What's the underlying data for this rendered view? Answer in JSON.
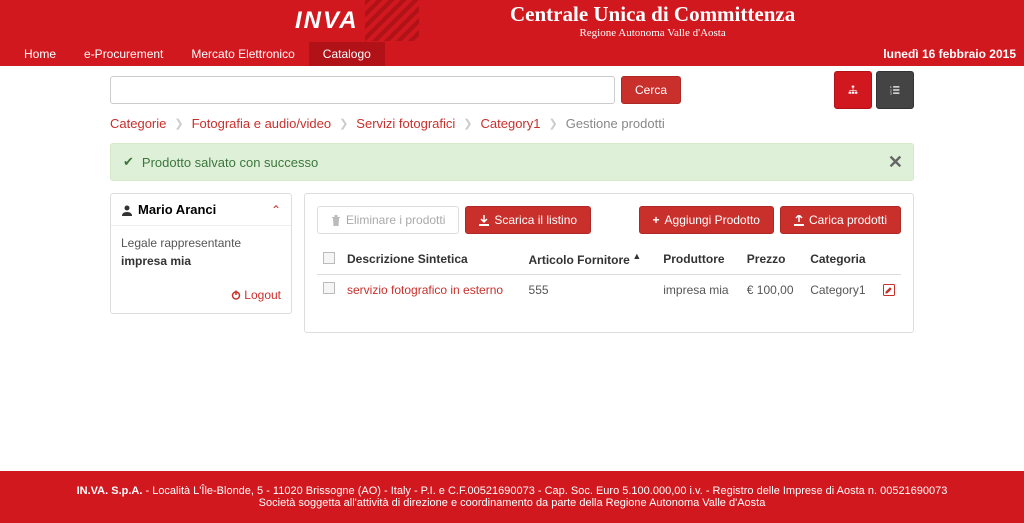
{
  "header": {
    "logo": "INVA",
    "title": "Centrale Unica di Committenza",
    "subtitle": "Regione Autonoma Valle d'Aosta"
  },
  "nav": {
    "items": [
      "Home",
      "e-Procurement",
      "Mercato Elettronico",
      "Catalogo"
    ],
    "active_index": 3,
    "date": "lunedì 16 febbraio 2015"
  },
  "search": {
    "placeholder": "",
    "value": "",
    "button": "Cerca"
  },
  "breadcrumb": {
    "items": [
      "Categorie",
      "Fotografia e audio/video",
      "Servizi fotografici",
      "Category1"
    ],
    "current": "Gestione prodotti"
  },
  "alert": {
    "message": "Prodotto salvato con successo"
  },
  "sidebar": {
    "user": "Mario Aranci",
    "role": "Legale rappresentante",
    "company": "impresa mia",
    "logout": "Logout"
  },
  "toolbar": {
    "delete": "Eliminare i prodotti",
    "download": "Scarica il listino",
    "add": "Aggiungi Prodotto",
    "upload": "Carica prodotti"
  },
  "table": {
    "headers": {
      "desc": "Descrizione Sintetica",
      "article": "Articolo Fornitore",
      "producer": "Produttore",
      "price": "Prezzo",
      "category": "Categoria"
    },
    "sorted_column": "article",
    "rows": [
      {
        "desc": "servizio fotografico in esterno",
        "article": "555",
        "producer": "impresa mia",
        "price": "€ 100,00",
        "category": "Category1"
      }
    ]
  },
  "footer": {
    "company": "IN.VA. S.p.A.",
    "line1": " - Località L'Île-Blonde, 5 - 11020 Brissogne (AO) - Italy - P.I. e C.F.00521690073 - Cap. Soc. Euro 5.100.000,00 i.v. - Registro delle Imprese di Aosta n. 00521690073",
    "line2": "Società soggetta all'attività di direzione e coordinamento da parte della Regione Autonoma Valle d'Aosta"
  }
}
